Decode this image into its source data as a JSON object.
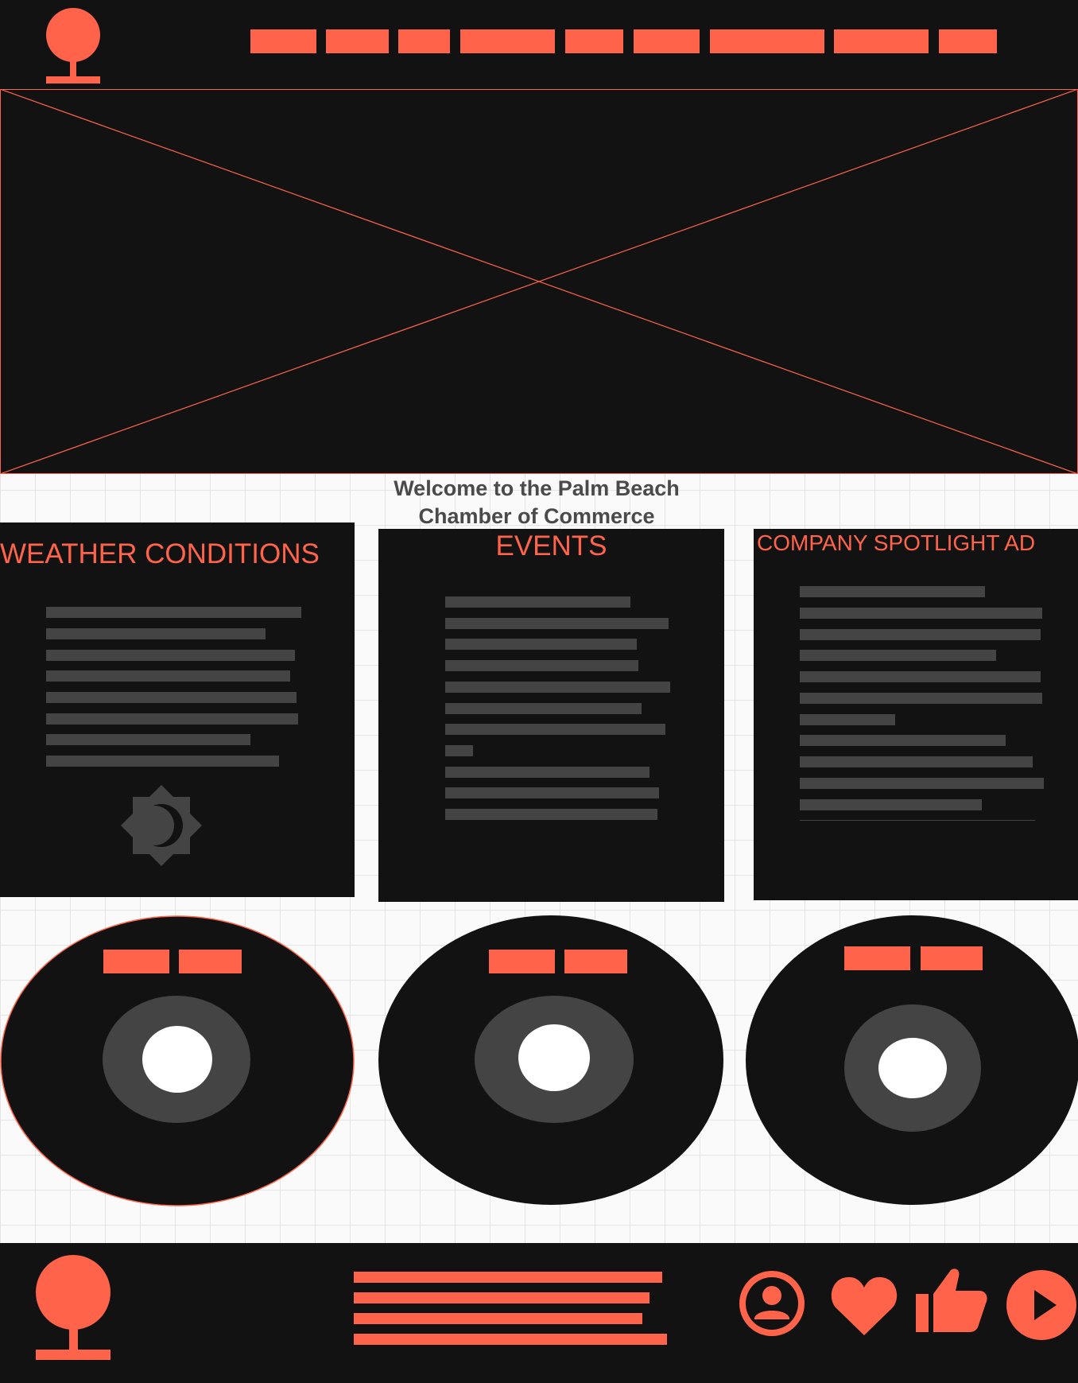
{
  "page": {
    "welcome_line1": "Welcome to the Palm Beach",
    "welcome_line2": "Chamber of Commerce"
  },
  "header": {
    "logo_icon": "tree-icon",
    "nav_placeholder_count_label": ""
  },
  "hero": {
    "type": "image-placeholder"
  },
  "cards": [
    {
      "title": "WEATHER CONDITIONS",
      "icon": "weather-sun-moon-icon"
    },
    {
      "title": "EVENTS"
    },
    {
      "title": "COMPANY SPOTLIGHT AD"
    }
  ],
  "media": [
    {
      "type": "disc-player"
    },
    {
      "type": "disc-player"
    },
    {
      "type": "disc-player"
    }
  ],
  "footer": {
    "logo_icon": "tree-icon",
    "social_icons": [
      "user-icon",
      "heart-icon",
      "thumbs-up-icon",
      "play-icon"
    ]
  },
  "colors": {
    "accent": "#ff644b",
    "dark": "#131213",
    "bar": "#444444",
    "text": "#4a4a4a"
  }
}
